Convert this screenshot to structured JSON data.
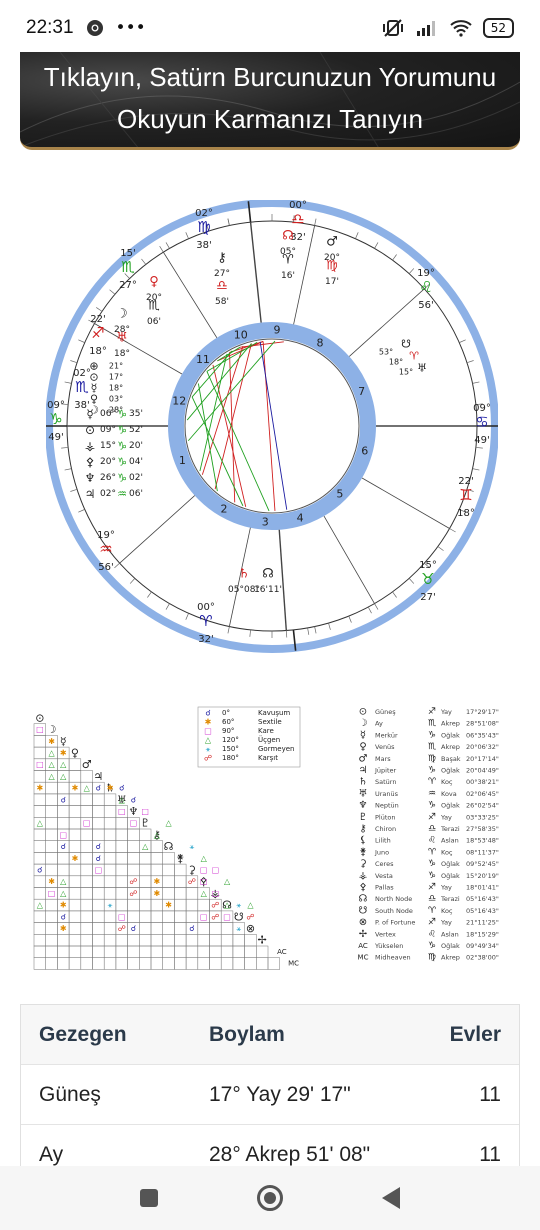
{
  "status_bar": {
    "time": "22:31",
    "dots": "•••",
    "battery": "52"
  },
  "banner": {
    "line1": "Tıklayın, Satürn Burcunuzun Yorumunu",
    "line2": "Okuyun Karmanızı Tanıyın"
  },
  "natal_chart": {
    "house_numbers": [
      "1",
      "2",
      "3",
      "4",
      "5",
      "6",
      "7",
      "8",
      "9",
      "10",
      "11",
      "12"
    ],
    "cusps": [
      {
        "deg": "09°",
        "sign_glyph": "♑",
        "min": "49'"
      },
      {
        "deg": "19°",
        "sign_glyph": "♒",
        "min": "56'"
      },
      {
        "deg": "00°",
        "sign_glyph": "♈",
        "min": "32'"
      },
      {
        "deg": "15°",
        "sign_glyph": "♉",
        "min": "27'"
      },
      {
        "deg": "22'",
        "sign_glyph": "♊",
        "min": "18°"
      },
      {
        "deg": "09°",
        "sign_glyph": "♋",
        "min": "49'"
      },
      {
        "deg": "19°",
        "sign_glyph": "♌",
        "min": "56'"
      },
      {
        "deg": "00°",
        "sign_glyph": "♎",
        "min": "32'"
      },
      {
        "deg": "02°",
        "sign_glyph": "♍",
        "min": "38'"
      },
      {
        "deg": "15'",
        "sign_glyph": "♏",
        "min": "27°"
      },
      {
        "deg": "22'",
        "sign_glyph": "♐",
        "min": "18°"
      },
      {
        "deg": "02°",
        "sign_glyph": "♏",
        "min": "38'"
      }
    ],
    "planet_labels": [
      {
        "glyph": "⚷",
        "text": "27°"
      },
      {
        "glyph": "♎",
        "text": "58'"
      },
      {
        "glyph": "☊",
        "text": "05°"
      },
      {
        "glyph": "♈",
        "text": "16'"
      },
      {
        "glyph": "♂",
        "text": "20°"
      },
      {
        "glyph": "♍",
        "text": "17'"
      },
      {
        "glyph": "♀",
        "text": "20°"
      },
      {
        "glyph": "♏",
        "text": "06'"
      },
      {
        "glyph": "☽",
        "text": "28°"
      },
      {
        "glyph": "♅",
        "text": "18°"
      },
      {
        "glyph": "♄",
        "text": "05°08°"
      },
      {
        "glyph": "☊",
        "text": "16'11'"
      }
    ],
    "left_column": [
      {
        "glyph": "☿",
        "deg": "06°",
        "sign": "♑",
        "min": "35'"
      },
      {
        "glyph": "⊙",
        "deg": "09°",
        "sign": "♑",
        "min": "52'"
      },
      {
        "glyph": "⚶",
        "deg": "15°",
        "sign": "♑",
        "min": "20'"
      },
      {
        "glyph": "⚴",
        "deg": "20°",
        "sign": "♑",
        "min": "04'"
      },
      {
        "glyph": "♆",
        "deg": "26°",
        "sign": "♑",
        "min": "02'"
      },
      {
        "glyph": "♃",
        "deg": "02°",
        "sign": "♒",
        "min": "06'"
      }
    ],
    "upper_left": [
      {
        "glyph": "⊕",
        "text": "21°"
      },
      {
        "glyph": "⊙",
        "text": "17°"
      },
      {
        "glyph": "☿",
        "text": "18°"
      },
      {
        "glyph": "♀",
        "text": "03°"
      },
      {
        "glyph": "☽",
        "text": "28°"
      }
    ],
    "right_side": [
      {
        "glyph": "☋",
        "text": "53°"
      },
      {
        "glyph": "♈",
        "text": "18°"
      },
      {
        "glyph": "♅",
        "text": "15°"
      }
    ]
  },
  "aspect_legend": [
    {
      "glyph": "☌",
      "deg": "0°",
      "name": "Kavuşum",
      "color": "#1a1aa0"
    },
    {
      "glyph": "✱",
      "deg": "60°",
      "name": "Sextile",
      "color": "#e08a00"
    },
    {
      "glyph": "□",
      "deg": "90°",
      "name": "Kare",
      "color": "#d13ad1"
    },
    {
      "glyph": "△",
      "deg": "120°",
      "name": "Üçgen",
      "color": "#2aa02a"
    },
    {
      "glyph": "⚹",
      "deg": "150°",
      "name": "Gormeyen",
      "color": "#1fa0c8"
    },
    {
      "glyph": "☍",
      "deg": "180°",
      "name": "Karşıt",
      "color": "#d02020"
    }
  ],
  "aspect_grid_planets": [
    "⊙",
    "☽",
    "☿",
    "♀",
    "♂",
    "♃",
    "♄",
    "♅",
    "♆",
    "♇",
    "⚷",
    "☊",
    "⚵",
    "⚳",
    "⚴",
    "⚶",
    "☊",
    "☋",
    "⊗",
    "✢",
    "AC",
    "MC"
  ],
  "aspect_grid_cells": [
    {
      "r": 1,
      "c": 0,
      "g": "□",
      "k": 2
    },
    {
      "r": 2,
      "c": 1,
      "g": "✱",
      "k": 1
    },
    {
      "r": 3,
      "c": 1,
      "g": "△",
      "k": 3
    },
    {
      "r": 3,
      "c": 2,
      "g": "✱",
      "k": 1
    },
    {
      "r": 4,
      "c": 0,
      "g": "□",
      "k": 2
    },
    {
      "r": 4,
      "c": 1,
      "g": "△",
      "k": 3
    },
    {
      "r": 4,
      "c": 2,
      "g": "△",
      "k": 3
    },
    {
      "r": 5,
      "c": 1,
      "g": "△",
      "k": 3
    },
    {
      "r": 5,
      "c": 2,
      "g": "△",
      "k": 3
    },
    {
      "r": 6,
      "c": 0,
      "g": "✱",
      "k": 1
    },
    {
      "r": 6,
      "c": 3,
      "g": "✱",
      "k": 1
    },
    {
      "r": 6,
      "c": 4,
      "g": "△",
      "k": 3
    },
    {
      "r": 6,
      "c": 5,
      "g": "☌",
      "k": 0
    },
    {
      "r": 6,
      "c": 6,
      "g": "✱",
      "k": 1
    },
    {
      "r": 6,
      "c": 7,
      "g": "☌",
      "k": 0
    },
    {
      "r": 7,
      "c": 2,
      "g": "☌",
      "k": 0
    },
    {
      "r": 7,
      "c": 7,
      "g": "△",
      "k": 3
    },
    {
      "r": 7,
      "c": 8,
      "g": "☌",
      "k": 0
    },
    {
      "r": 8,
      "c": 7,
      "g": "□",
      "k": 2
    },
    {
      "r": 8,
      "c": 9,
      "g": "□",
      "k": 2
    },
    {
      "r": 9,
      "c": 0,
      "g": "△",
      "k": 3
    },
    {
      "r": 9,
      "c": 4,
      "g": "□",
      "k": 2
    },
    {
      "r": 9,
      "c": 8,
      "g": "□",
      "k": 2
    },
    {
      "r": 9,
      "c": 11,
      "g": "△",
      "k": 3
    },
    {
      "r": 10,
      "c": 2,
      "g": "□",
      "k": 2
    },
    {
      "r": 10,
      "c": 10,
      "g": "△",
      "k": 3
    },
    {
      "r": 11,
      "c": 2,
      "g": "☌",
      "k": 0
    },
    {
      "r": 11,
      "c": 5,
      "g": "☌",
      "k": 0
    },
    {
      "r": 11,
      "c": 9,
      "g": "△",
      "k": 3
    },
    {
      "r": 11,
      "c": 13,
      "g": "⚹",
      "k": 4
    },
    {
      "r": 12,
      "c": 3,
      "g": "✱",
      "k": 1
    },
    {
      "r": 12,
      "c": 5,
      "g": "☌",
      "k": 0
    },
    {
      "r": 12,
      "c": 14,
      "g": "△",
      "k": 3
    },
    {
      "r": 13,
      "c": 0,
      "g": "☌",
      "k": 0
    },
    {
      "r": 13,
      "c": 5,
      "g": "□",
      "k": 2
    },
    {
      "r": 13,
      "c": 14,
      "g": "□",
      "k": 2
    },
    {
      "r": 13,
      "c": 15,
      "g": "□",
      "k": 2
    },
    {
      "r": 14,
      "c": 1,
      "g": "✱",
      "k": 1
    },
    {
      "r": 14,
      "c": 2,
      "g": "△",
      "k": 3
    },
    {
      "r": 14,
      "c": 8,
      "g": "☍",
      "k": 5
    },
    {
      "r": 14,
      "c": 10,
      "g": "✱",
      "k": 1
    },
    {
      "r": 14,
      "c": 13,
      "g": "☍",
      "k": 5
    },
    {
      "r": 14,
      "c": 14,
      "g": "□",
      "k": 2
    },
    {
      "r": 14,
      "c": 16,
      "g": "△",
      "k": 3
    },
    {
      "r": 15,
      "c": 1,
      "g": "□",
      "k": 2
    },
    {
      "r": 15,
      "c": 2,
      "g": "△",
      "k": 3
    },
    {
      "r": 15,
      "c": 8,
      "g": "☍",
      "k": 5
    },
    {
      "r": 15,
      "c": 10,
      "g": "✱",
      "k": 1
    },
    {
      "r": 15,
      "c": 14,
      "g": "△",
      "k": 3
    },
    {
      "r": 15,
      "c": 15,
      "g": "□",
      "k": 2
    },
    {
      "r": 16,
      "c": 0,
      "g": "△",
      "k": 3
    },
    {
      "r": 16,
      "c": 2,
      "g": "✱",
      "k": 1
    },
    {
      "r": 16,
      "c": 6,
      "g": "⚹",
      "k": 4
    },
    {
      "r": 16,
      "c": 11,
      "g": "✱",
      "k": 1
    },
    {
      "r": 16,
      "c": 15,
      "g": "☍",
      "k": 5
    },
    {
      "r": 16,
      "c": 16,
      "g": "△",
      "k": 3
    },
    {
      "r": 16,
      "c": 17,
      "g": "⚹",
      "k": 4
    },
    {
      "r": 16,
      "c": 18,
      "g": "△",
      "k": 3
    },
    {
      "r": 17,
      "c": 2,
      "g": "☌",
      "k": 0
    },
    {
      "r": 17,
      "c": 7,
      "g": "□",
      "k": 2
    },
    {
      "r": 17,
      "c": 14,
      "g": "□",
      "k": 2
    },
    {
      "r": 17,
      "c": 15,
      "g": "☍",
      "k": 5
    },
    {
      "r": 17,
      "c": 16,
      "g": "□",
      "k": 2
    },
    {
      "r": 17,
      "c": 18,
      "g": "☍",
      "k": 5
    },
    {
      "r": 18,
      "c": 2,
      "g": "✱",
      "k": 1
    },
    {
      "r": 18,
      "c": 7,
      "g": "☍",
      "k": 5
    },
    {
      "r": 18,
      "c": 8,
      "g": "☌",
      "k": 0
    },
    {
      "r": 18,
      "c": 13,
      "g": "☌",
      "k": 0
    },
    {
      "r": 18,
      "c": 17,
      "g": "⚹",
      "k": 4
    }
  ],
  "planet_table": [
    {
      "glyph": "⊙",
      "name": "Güneş",
      "sign_glyph": "♐",
      "sign": "Yay",
      "pos": "17°29'17\""
    },
    {
      "glyph": "☽",
      "name": "Ay",
      "sign_glyph": "♏",
      "sign": "Akrep",
      "pos": "28°51'08\""
    },
    {
      "glyph": "☿",
      "name": "Merkür",
      "sign_glyph": "♑",
      "sign": "Oğlak",
      "pos": "06°35'43\""
    },
    {
      "glyph": "♀",
      "name": "Venüs",
      "sign_glyph": "♏",
      "sign": "Akrep",
      "pos": "20°06'32\""
    },
    {
      "glyph": "♂",
      "name": "Mars",
      "sign_glyph": "♍",
      "sign": "Başak",
      "pos": "20°17'14\""
    },
    {
      "glyph": "♃",
      "name": "Jüpiter",
      "sign_glyph": "♑",
      "sign": "Oğlak",
      "pos": "20°04'49\""
    },
    {
      "glyph": "♄",
      "name": "Satürn",
      "sign_glyph": "♈",
      "sign": "Koç",
      "pos": "00°38'21\""
    },
    {
      "glyph": "♅",
      "name": "Uranüs",
      "sign_glyph": "♒",
      "sign": "Kova",
      "pos": "02°06'45\""
    },
    {
      "glyph": "♆",
      "name": "Neptün",
      "sign_glyph": "♑",
      "sign": "Oğlak",
      "pos": "26°02'54\""
    },
    {
      "glyph": "♇",
      "name": "Plüton",
      "sign_glyph": "♐",
      "sign": "Yay",
      "pos": "03°33'25\""
    },
    {
      "glyph": "⚷",
      "name": "Chiron",
      "sign_glyph": "♎",
      "sign": "Terazi",
      "pos": "27°58'35\""
    },
    {
      "glyph": "⚸",
      "name": "Lilith",
      "sign_glyph": "♌",
      "sign": "Aslan",
      "pos": "18°53'48\""
    },
    {
      "glyph": "⚵",
      "name": "Juno",
      "sign_glyph": "♈",
      "sign": "Koç",
      "pos": "08°11'37\""
    },
    {
      "glyph": "⚳",
      "name": "Ceres",
      "sign_glyph": "♑",
      "sign": "Oğlak",
      "pos": "09°52'45\""
    },
    {
      "glyph": "⚶",
      "name": "Vesta",
      "sign_glyph": "♑",
      "sign": "Oğlak",
      "pos": "15°20'19\""
    },
    {
      "glyph": "⚴",
      "name": "Pallas",
      "sign_glyph": "♐",
      "sign": "Yay",
      "pos": "18°01'41\""
    },
    {
      "glyph": "☊",
      "name": "North Node",
      "sign_glyph": "♎",
      "sign": "Terazi",
      "pos": "05°16'43\""
    },
    {
      "glyph": "☋",
      "name": "South Node",
      "sign_glyph": "♈",
      "sign": "Koç",
      "pos": "05°16'43\""
    },
    {
      "glyph": "⊗",
      "name": "P. of Fortune",
      "sign_glyph": "♐",
      "sign": "Yay",
      "pos": "21°11'25\""
    },
    {
      "glyph": "✢",
      "name": "Vertex",
      "sign_glyph": "♌",
      "sign": "Aslan",
      "pos": "18°15'29\""
    },
    {
      "glyph": "AC",
      "name": "Yükselen",
      "sign_glyph": "♑",
      "sign": "Oğlak",
      "pos": "09°49'34\""
    },
    {
      "glyph": "MC",
      "name": "Midheaven",
      "sign_glyph": "♍",
      "sign": "Akrep",
      "pos": "02°38'00\""
    }
  ],
  "table": {
    "headers": [
      "Gezegen",
      "Boylam",
      "Evler"
    ],
    "rows": [
      {
        "planet": "Güneş",
        "longitude": "17° Yay 29' 17\"",
        "house": "11"
      },
      {
        "planet": "Ay",
        "longitude": "28° Akrep 51' 08\"",
        "house": "11"
      }
    ]
  },
  "colors": {
    "ring_blue": "#8db1e6",
    "sign_blue": "#1a1aa0",
    "red": "#d02020",
    "green": "#1fa01f",
    "gold": "#a8844a"
  }
}
